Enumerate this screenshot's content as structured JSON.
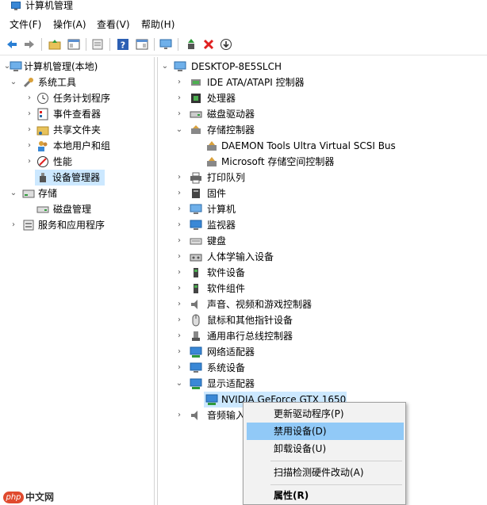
{
  "window": {
    "title": "计算机管理"
  },
  "menu": [
    "文件(F)",
    "操作(A)",
    "查看(V)",
    "帮助(H)"
  ],
  "toolbar": {
    "buttons": [
      "back-icon",
      "forward-icon",
      "up-folder-icon",
      "show-hide-tree-icon",
      "export-icon",
      "help-icon",
      "properties-icon",
      "monitor-icon",
      "update-driver-icon",
      "uninstall-icon",
      "disable-icon"
    ]
  },
  "left_tree": {
    "root": "计算机管理(本地)",
    "system_tools": "系统工具",
    "task_scheduler": "任务计划程序",
    "event_viewer": "事件查看器",
    "shared_folders": "共享文件夹",
    "local_users": "本地用户和组",
    "performance": "性能",
    "device_manager": "设备管理器",
    "storage": "存储",
    "disk_management": "磁盘管理",
    "services_apps": "服务和应用程序"
  },
  "right_tree": {
    "computer": "DESKTOP-8E5SLCH",
    "items": [
      "IDE ATA/ATAPI 控制器",
      "处理器",
      "磁盘驱动器",
      "存储控制器",
      "DAEMON Tools Ultra Virtual SCSI Bus",
      "Microsoft 存储空间控制器",
      "打印队列",
      "固件",
      "计算机",
      "监视器",
      "键盘",
      "人体学输入设备",
      "软件设备",
      "软件组件",
      "声音、视频和游戏控制器",
      "鼠标和其他指针设备",
      "通用串行总线控制器",
      "网络适配器",
      "系统设备",
      "显示适配器",
      "NVIDIA GeForce GTX 1650",
      "音频输入"
    ]
  },
  "context_menu": {
    "update": "更新驱动程序(P)",
    "disable": "禁用设备(D)",
    "uninstall": "卸载设备(U)",
    "scan": "扫描检测硬件改动(A)",
    "properties": "属性(R)"
  },
  "watermark": {
    "brand": "php",
    "text": "中文网"
  },
  "colors": {
    "selection": "#cce8ff",
    "menu_highlight": "#91c9f7",
    "accent": "#0078d7"
  }
}
